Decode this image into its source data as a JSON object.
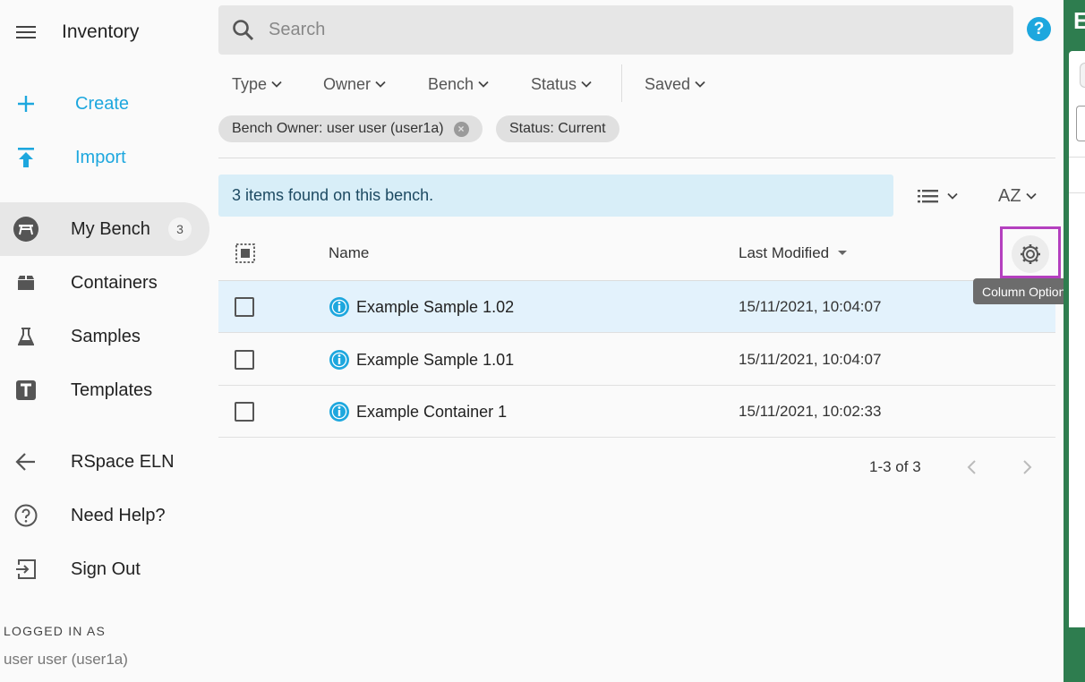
{
  "app": {
    "title": "Inventory"
  },
  "sidebar": {
    "actions": [
      {
        "label": "Create",
        "icon": "plus-icon"
      },
      {
        "label": "Import",
        "icon": "upload-icon"
      }
    ],
    "nav": [
      {
        "label": "My Bench",
        "icon": "bench-icon",
        "count": "3",
        "active": true
      },
      {
        "label": "Containers",
        "icon": "container-icon"
      },
      {
        "label": "Samples",
        "icon": "flask-icon"
      },
      {
        "label": "Templates",
        "icon": "template-icon"
      }
    ],
    "links": [
      {
        "label": "RSpace ELN",
        "icon": "arrow-left-icon"
      },
      {
        "label": "Need Help?",
        "icon": "help-circle-icon"
      },
      {
        "label": "Sign Out",
        "icon": "sign-out-icon"
      }
    ],
    "logged_in_label": "LOGGED IN AS",
    "logged_in_user": "user user (user1a)"
  },
  "search": {
    "placeholder": "Search",
    "value": ""
  },
  "filters": [
    "Type",
    "Owner",
    "Bench",
    "Status",
    "Saved"
  ],
  "chips": [
    {
      "label": "Bench Owner: user user (user1a)",
      "removable": true
    },
    {
      "label": "Status: Current",
      "removable": false
    }
  ],
  "results": {
    "message": "3 items found on this bench.",
    "sort_label": "AZ"
  },
  "table": {
    "columns": {
      "name": "Name",
      "modified": "Last Modified"
    },
    "column_options_tooltip": "Column Options",
    "rows": [
      {
        "name": "Example Sample 1.02",
        "modified": "15/11/2021, 10:04:07",
        "selected_highlight": true
      },
      {
        "name": "Example Sample 1.01",
        "modified": "15/11/2021, 10:04:07"
      },
      {
        "name": "Example Container 1",
        "modified": "15/11/2021, 10:02:33"
      }
    ],
    "pagination": "1-3 of 3"
  },
  "colors": {
    "accent": "#1da7de",
    "highlight_row": "#e3f2fc",
    "info_bar": "#d8eef8",
    "focus_outline": "#b43fbf",
    "edge_panel": "#2e7d4f"
  },
  "edge_panel": {
    "initial": "E"
  }
}
